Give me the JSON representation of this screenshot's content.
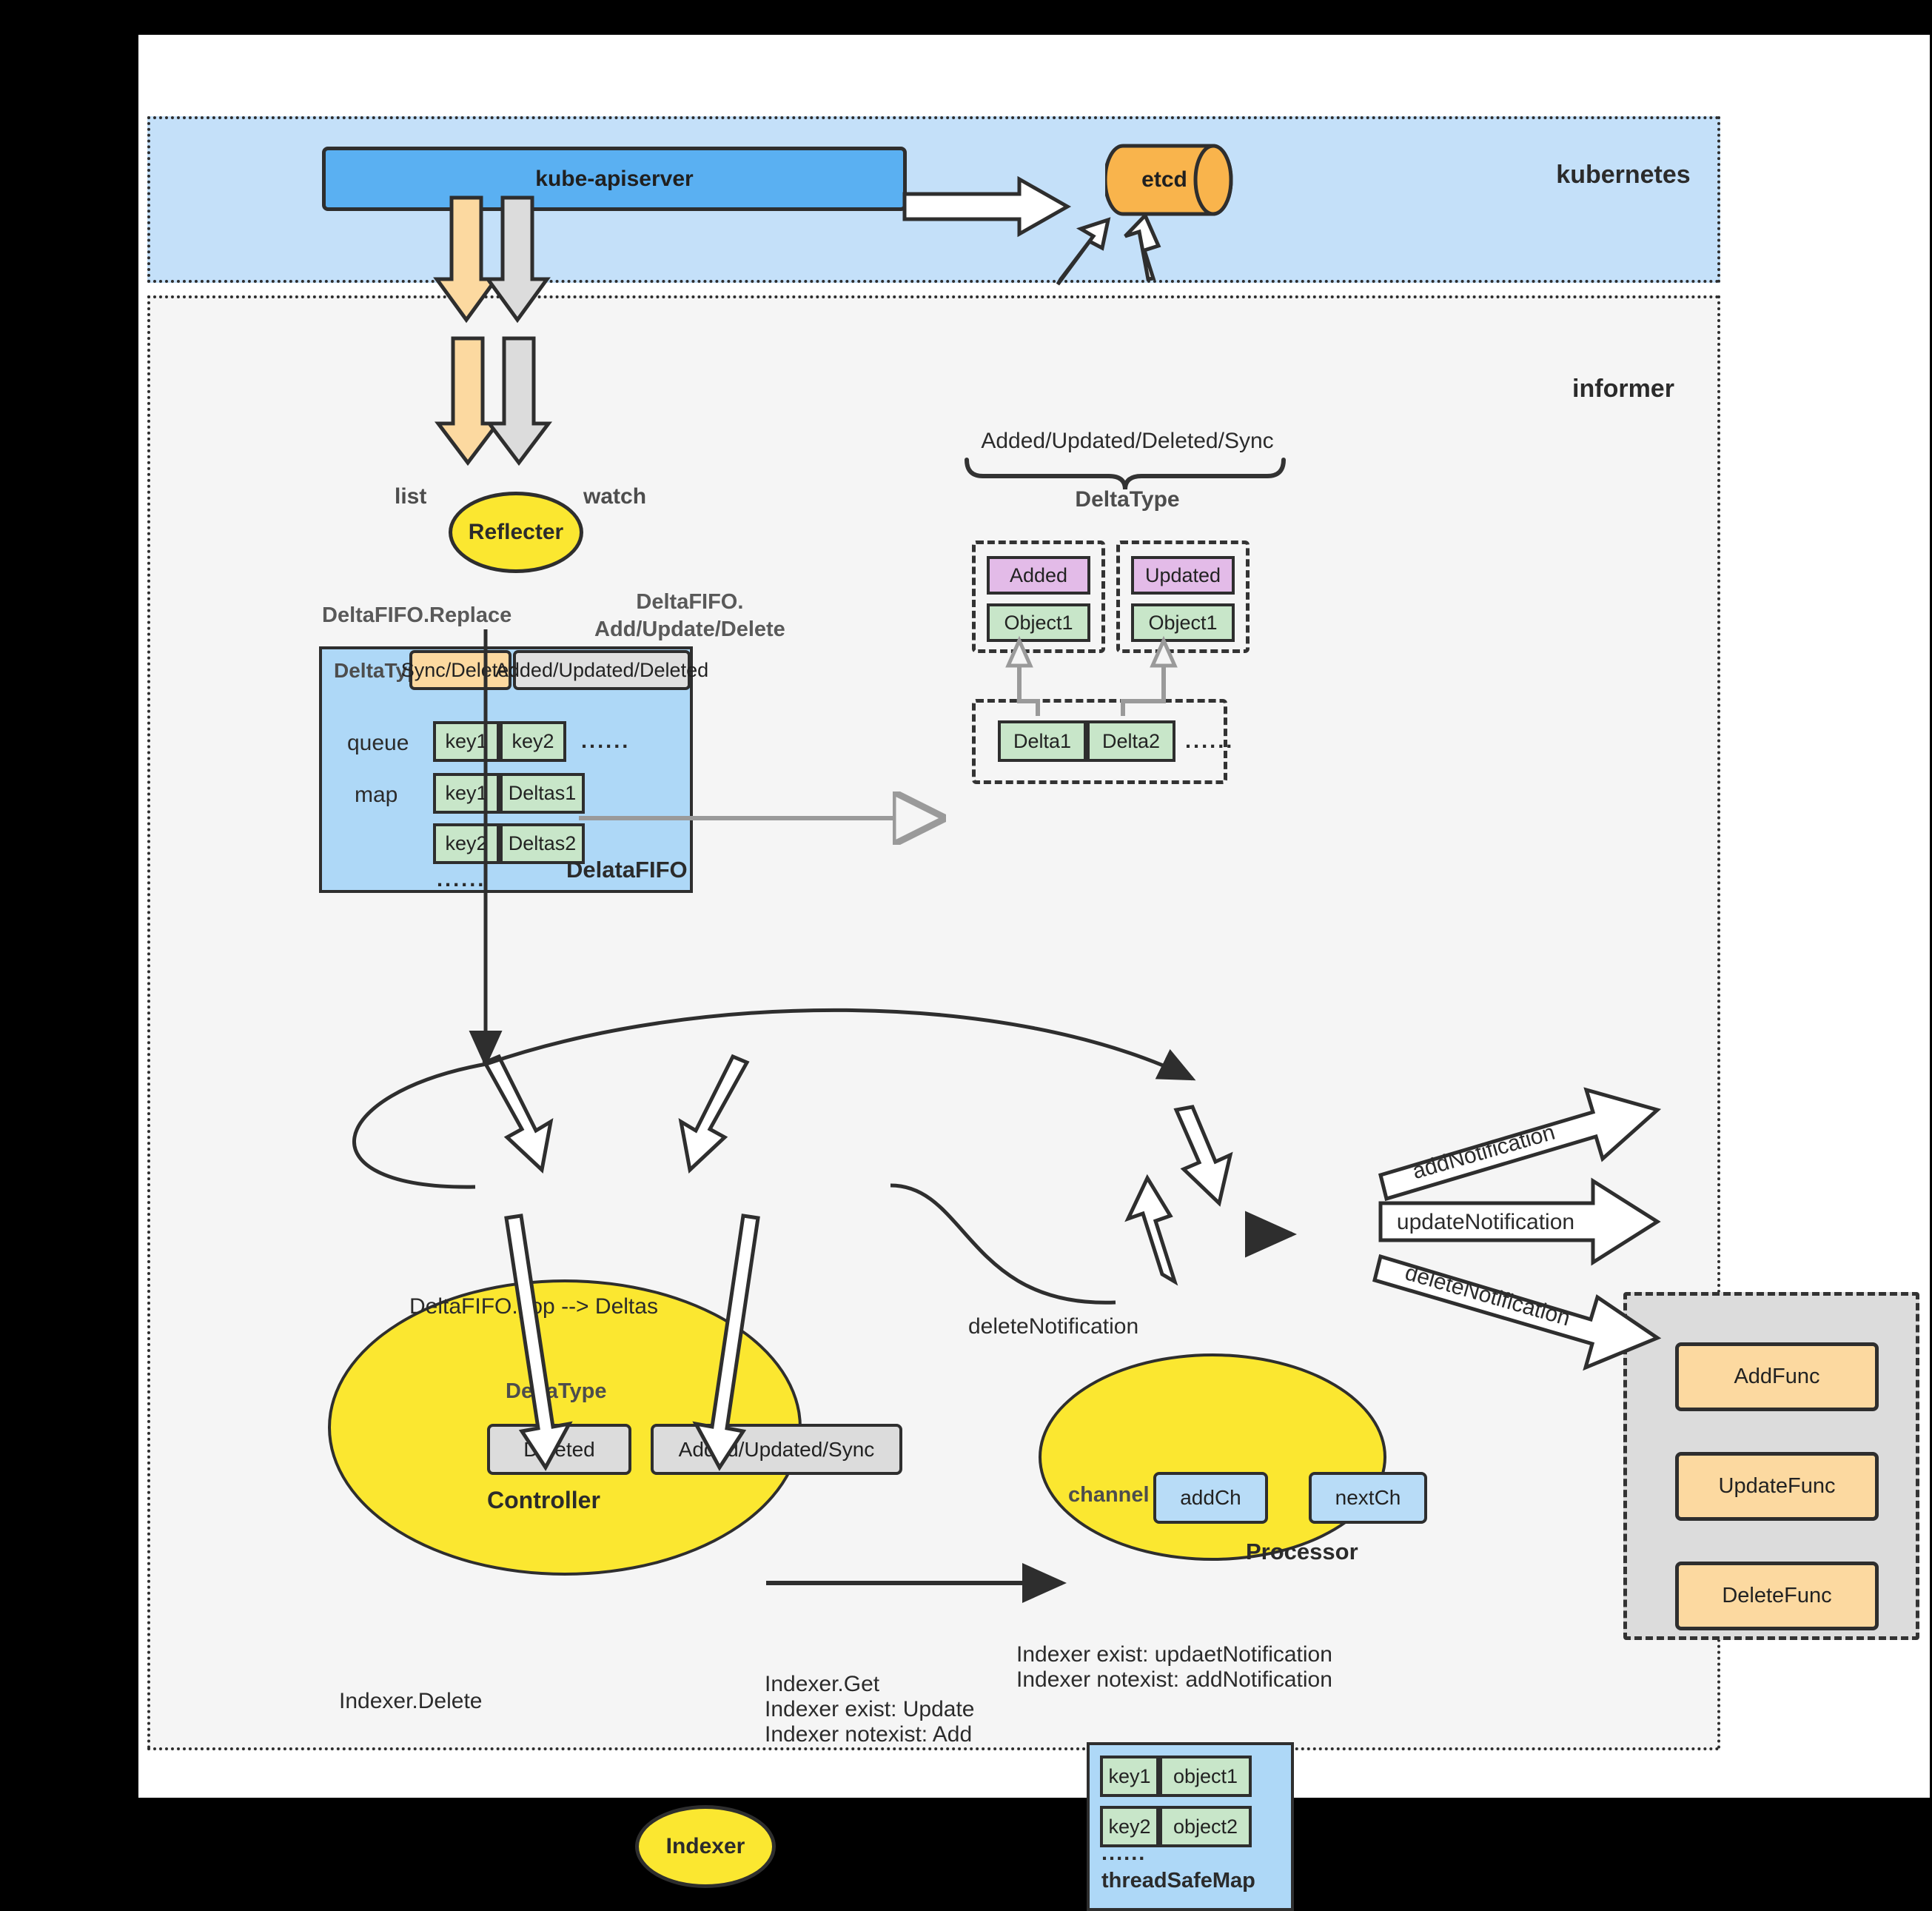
{
  "regions": {
    "kubernetes_title": "kubernetes",
    "informer_title": "informer",
    "handlers_title": ""
  },
  "kubernetes": {
    "apiserver": "kube-apiserver",
    "etcd": "etcd"
  },
  "reflecter": {
    "name": "Reflecter",
    "in_list": "list",
    "in_watch": "watch",
    "out_replace": "DeltaFIFO.Replace",
    "out_addupdatedelete_line1": "DeltaFIFO.",
    "out_addupdatedelete_line2": "Add/Update/Delete"
  },
  "deltafifo": {
    "title": "DelataFIFO",
    "deltatype_label": "DeltaType",
    "tag_sync": "Sync/Deleted",
    "tag_added": "Added/Updated/Deleted",
    "queue_label": "queue",
    "queue_cells": [
      "key1",
      "key2"
    ],
    "queue_ellipsis": "......",
    "map_label": "map",
    "map_rows": [
      {
        "key": "key1",
        "value": "Deltas1"
      },
      {
        "key": "key2",
        "value": "Deltas2"
      }
    ],
    "map_ellipsis": "......"
  },
  "deltatype_detail": {
    "brace_label": "Added/Updated/Deleted/Sync",
    "brace_word": "DeltaType",
    "groups": [
      {
        "type": "Added",
        "object": "Object1"
      },
      {
        "type": "Updated",
        "object": "Object1"
      }
    ],
    "deltas": [
      "Delta1",
      "Delta2"
    ],
    "deltas_ellipsis": "......"
  },
  "controller": {
    "title": "Controller",
    "deltatype_label": "DeltaType",
    "branch_deleted": "Deleted",
    "branch_added": "Added/Updated/Sync",
    "in_label": "DeltaFIFO.pop --> Deltas",
    "out_delete": "Indexer.Delete",
    "out_get_line1": "Indexer.Get",
    "out_get_line2": "Indexer exist:  Update",
    "out_get_line3": "Indexer notexist:  Add"
  },
  "processor": {
    "title": "Processor",
    "channel_label": "channel",
    "addch": "addCh",
    "nextch": "nextCh",
    "delete_notification": "deleteNotification",
    "note_line1": "Indexer exist:  updaetNotification",
    "note_line2": "Indexer notexist:  addNotification"
  },
  "handlers": {
    "arrows": [
      "addNotification",
      "updateNotification",
      "deleteNotification"
    ],
    "funcs": [
      "AddFunc",
      "UpdateFunc",
      "DeleteFunc"
    ]
  },
  "indexer": {
    "name": "Indexer",
    "store_title": "threadSafeMap",
    "store_rows": [
      {
        "key": "key1",
        "value": "object1"
      },
      {
        "key": "key2",
        "value": "object2"
      }
    ],
    "store_ellipsis": "......"
  },
  "colors": {
    "k8s_region": "#c4e0f9",
    "informer_region": "#f5f5f5",
    "apiserver": "#5ab0f2",
    "etcd": "#f9b44c",
    "yellow": "#fbe730",
    "green": "#c8e6c9",
    "purple": "#e3bbe8",
    "orange": "#fcd9a0",
    "gray": "#dcdcdc",
    "lightblue": "#aed8f7"
  }
}
